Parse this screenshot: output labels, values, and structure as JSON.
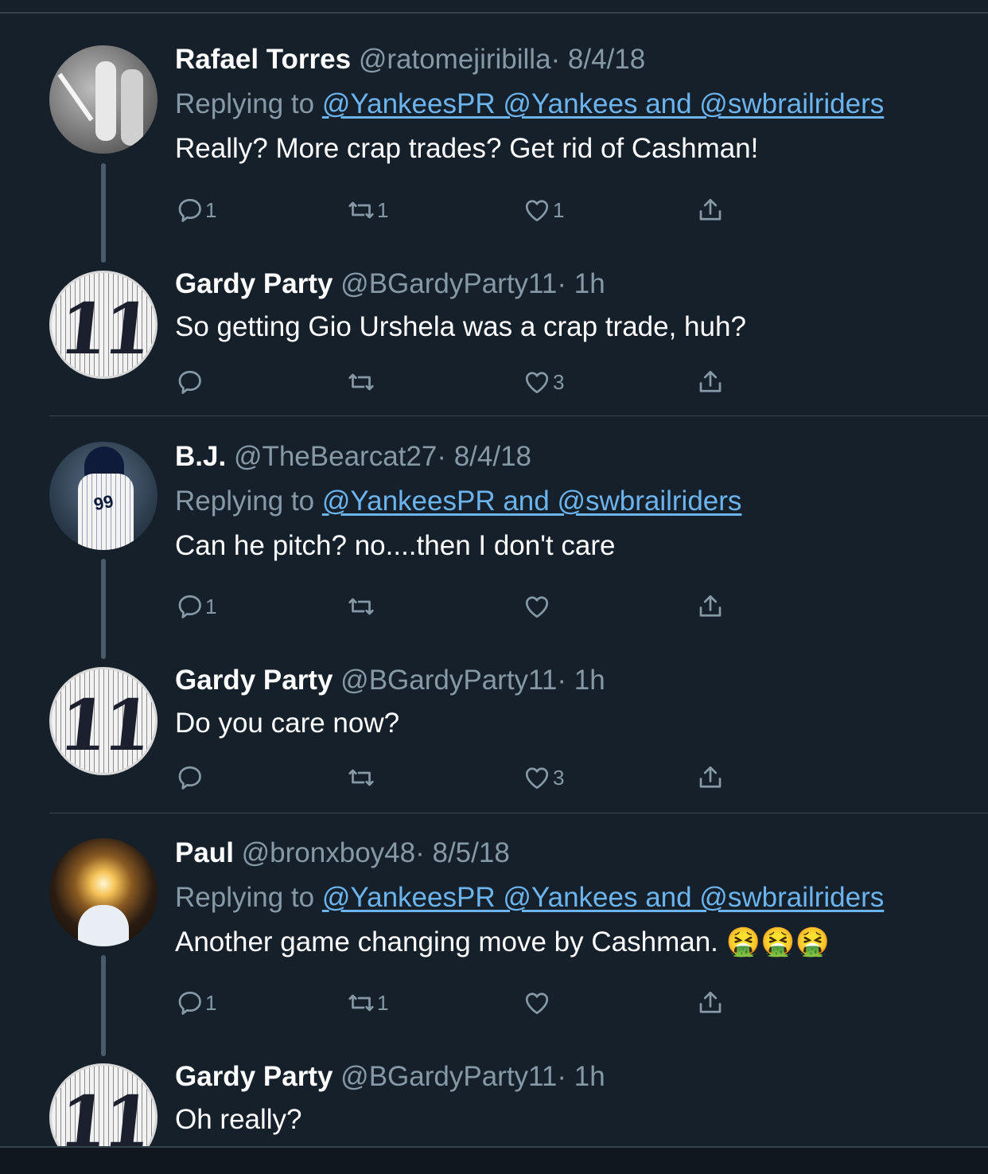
{
  "tweets": [
    {
      "name": "Rafael Torres",
      "handle": "@ratomejiribilla",
      "time": "· 8/4/18",
      "reply_prefix": "Replying to",
      "reply_to": "@YankeesPR @Yankees and @swbrailriders",
      "text": "Really? More crap trades? Get rid of Cashman!",
      "replies": "1",
      "retweets": "1",
      "likes": "1",
      "avatar": "batter-photo-avatar"
    },
    {
      "name": "Gardy Party",
      "handle": "@BGardyParty11",
      "time": "· 1h",
      "text": "So getting Gio Urshela was a crap trade, huh?",
      "replies": "",
      "retweets": "",
      "likes": "3",
      "avatar_number": "11"
    },
    {
      "name": "B.J.",
      "handle": "@TheBearcat27",
      "time": "· 8/4/18",
      "reply_prefix": "Replying to",
      "reply_to": "@YankeesPR and @swbrailriders",
      "text": "Can he pitch? no....then I don't care",
      "replies": "1",
      "retweets": "",
      "likes": "",
      "avatar_number": "99"
    },
    {
      "name": "Gardy Party",
      "handle": "@BGardyParty11",
      "time": "· 1h",
      "text": "Do you care now?",
      "replies": "",
      "retweets": "",
      "likes": "3",
      "avatar_number": "11"
    },
    {
      "name": "Paul",
      "handle": "@bronxboy48",
      "time": "· 8/5/18",
      "reply_prefix": "Replying to",
      "reply_to": "@YankeesPR @Yankees and @swbrailriders",
      "text": "Another game changing move by Cashman. 🤮🤮🤮",
      "replies": "1",
      "retweets": "1",
      "likes": "",
      "avatar": "glowing-figure-avatar"
    },
    {
      "name": "Gardy Party",
      "handle": "@BGardyParty11",
      "time": "· 1h",
      "text": "Oh really?",
      "avatar_number": "11"
    }
  ],
  "colors": {
    "background": "#15202b",
    "secondary_text": "#8899a6",
    "link": "#6cb4ee",
    "divider": "#38444d"
  }
}
